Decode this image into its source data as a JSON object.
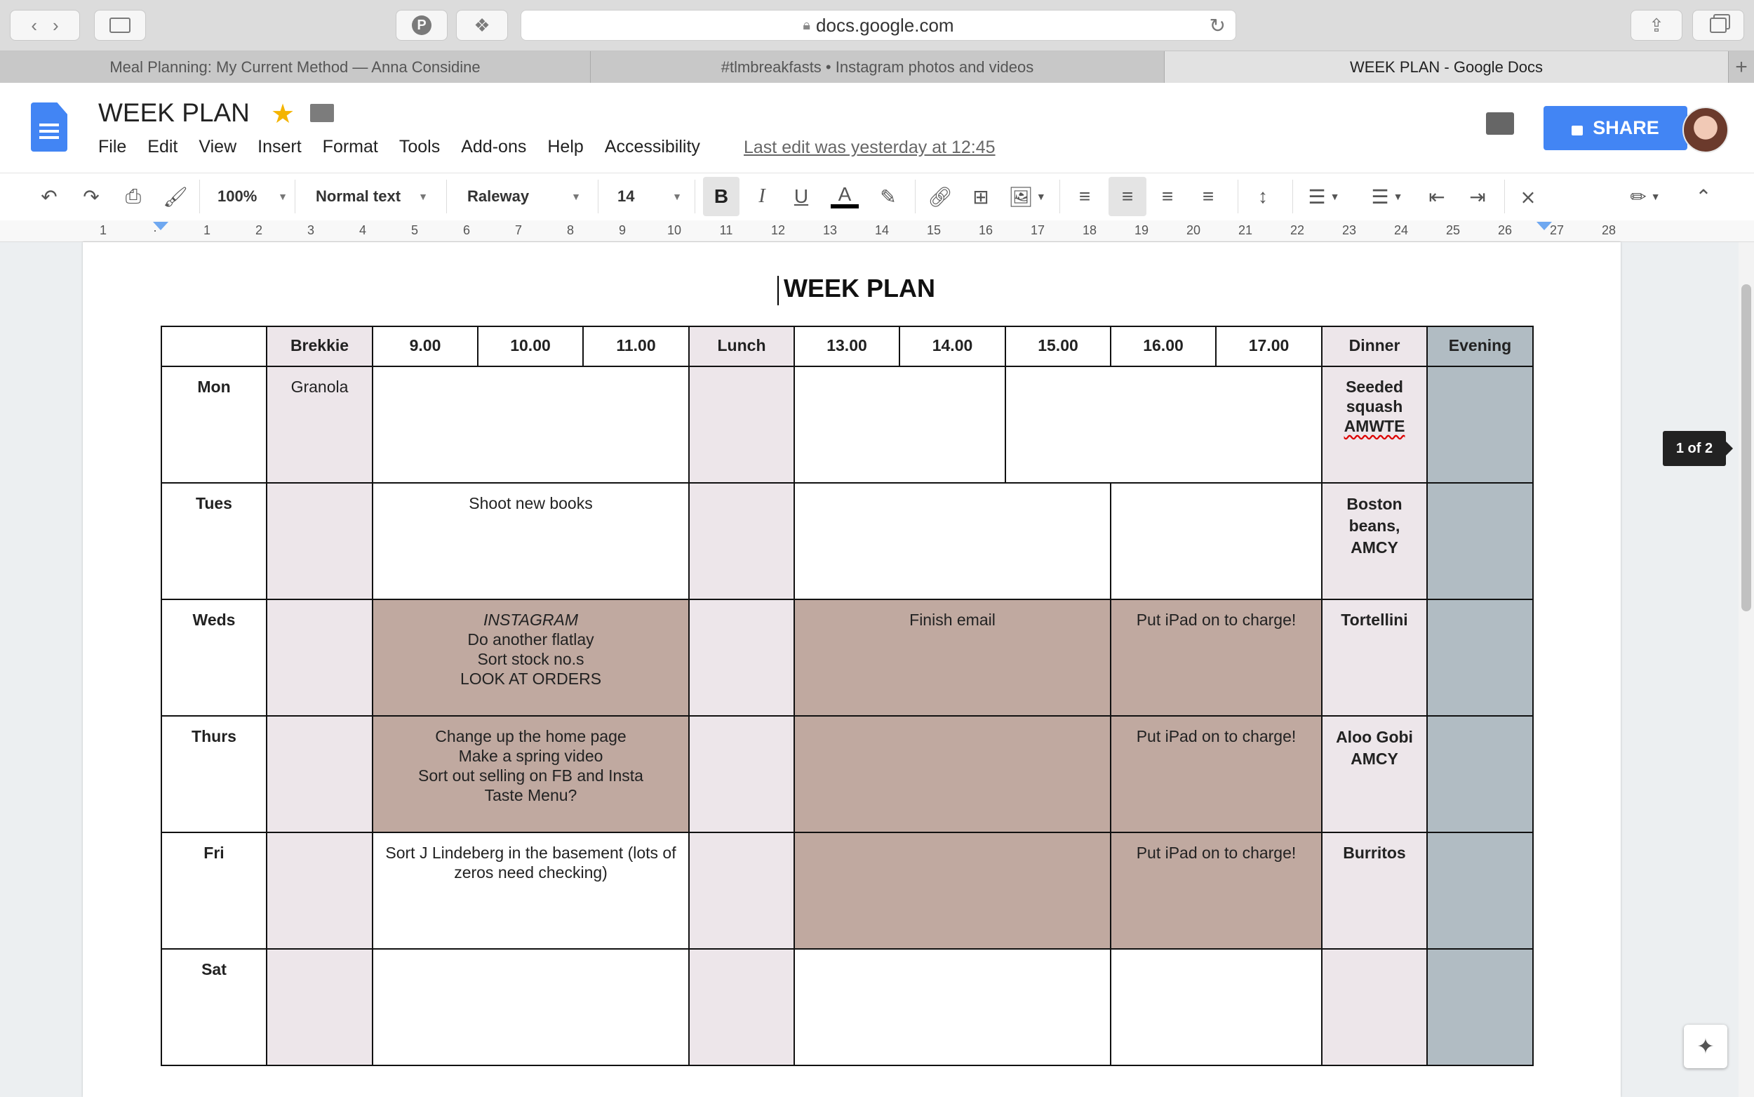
{
  "browser": {
    "url": "docs.google.com",
    "tabs": [
      {
        "title": "Meal Planning: My Current Method — Anna Considine",
        "active": false
      },
      {
        "title": "#tlmbreakfasts • Instagram photos and videos",
        "active": false
      },
      {
        "title": "WEEK PLAN - Google Docs",
        "active": true
      }
    ]
  },
  "docs": {
    "title": "WEEK PLAN",
    "menu": [
      "File",
      "Edit",
      "View",
      "Insert",
      "Format",
      "Tools",
      "Add-ons",
      "Help",
      "Accessibility"
    ],
    "last_edit": "Last edit was yesterday at 12:45",
    "share_label": "SHARE"
  },
  "toolbar": {
    "zoom": "100%",
    "style": "Normal text",
    "font": "Raleway",
    "size": "14"
  },
  "ruler": [
    "1",
    "·",
    "1",
    "2",
    "3",
    "4",
    "5",
    "6",
    "7",
    "8",
    "9",
    "10",
    "11",
    "12",
    "13",
    "14",
    "15",
    "16",
    "17",
    "18",
    "19",
    "20",
    "21",
    "22",
    "23",
    "24",
    "25",
    "26",
    "27",
    "28"
  ],
  "document": {
    "heading": "WEEK PLAN",
    "table": {
      "headers": [
        "",
        "Brekkie",
        "9.00",
        "10.00",
        "11.00",
        "Lunch",
        "13.00",
        "14.00",
        "15.00",
        "16.00",
        "17.00",
        "Dinner",
        "Evening"
      ],
      "rows": {
        "mon": {
          "day": "Mon",
          "brekkie": "Granola",
          "dinner_1": "Seeded",
          "dinner_2": "squash",
          "dinner_3": "AMWTE"
        },
        "tues": {
          "day": "Tues",
          "morning": "Shoot new books",
          "dinner_1": "Boston",
          "dinner_2": "beans,",
          "dinner_3": "AMCY"
        },
        "weds": {
          "day": "Weds",
          "morning_1": "INSTAGRAM",
          "morning_2": "Do another flatlay",
          "morning_3": "Sort stock no.s",
          "morning_4": "LOOK AT ORDERS",
          "afternoon": "Finish email",
          "late": "Put iPad on to charge!",
          "dinner": "Tortellini"
        },
        "thurs": {
          "day": "Thurs",
          "morning_1": "Change up the home page",
          "morning_2": "Make a spring video",
          "morning_3": "Sort out selling on FB and Insta",
          "morning_4": "Taste Menu?",
          "late": "Put iPad on to charge!",
          "dinner_1": "Aloo Gobi",
          "dinner_2": "AMCY"
        },
        "fri": {
          "day": "Fri",
          "morning": "Sort J Lindeberg in the basement (lots of zeros need checking)",
          "late": "Put iPad on to charge!",
          "dinner": "Burritos"
        },
        "sat": {
          "day": "Sat"
        }
      }
    }
  },
  "page_indicator": "1 of 2",
  "colors": {
    "share_blue": "#4285f4",
    "brekkie_lunch_dinner": "#ede6ea",
    "evening": "#b1bcc3",
    "busy": "#c0a9a0"
  }
}
